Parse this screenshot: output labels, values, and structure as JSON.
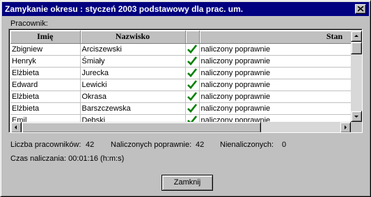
{
  "window": {
    "title": "Zamykanie okresu : styczeń 2003 podstawowy dla prac. um."
  },
  "group_label": "Pracownik:",
  "grid": {
    "columns": [
      "Imię",
      "Nazwisko",
      "",
      "Stan"
    ],
    "rows": [
      {
        "first": "Zbigniew",
        "last": "Arciszewski",
        "ok": true,
        "status": "naliczony poprawnie"
      },
      {
        "first": "Henryk",
        "last": "Śmiały",
        "ok": true,
        "status": "naliczony poprawnie"
      },
      {
        "first": "Elżbieta",
        "last": "Jurecka",
        "ok": true,
        "status": "naliczony poprawnie"
      },
      {
        "first": "Edward",
        "last": "Lewicki",
        "ok": true,
        "status": "naliczony poprawnie"
      },
      {
        "first": "Elżbieta",
        "last": "Okrasa",
        "ok": true,
        "status": "naliczony poprawnie"
      },
      {
        "first": "Elżbieta",
        "last": "Barszczewska",
        "ok": true,
        "status": "naliczony poprawnie"
      },
      {
        "first": "Emil",
        "last": "Dębski",
        "ok": true,
        "status": "naliczony poprawnie"
      }
    ],
    "check_color": "#008000"
  },
  "stats": {
    "employees_label": "Liczba pracowników:",
    "employees_value": "42",
    "correct_label": "Naliczonych poprawnie:",
    "correct_value": "42",
    "failed_label": "Nienaliczonych:",
    "failed_value": "0"
  },
  "time": {
    "text": "Czas naliczania: 00:01:16 (h:m:s)"
  },
  "buttons": {
    "close_label": "Zamknij"
  },
  "icons": {
    "close": "close-icon",
    "check": "check-icon",
    "arrow_up": "arrow-up-icon",
    "arrow_down": "arrow-down-icon",
    "arrow_left": "arrow-left-icon",
    "arrow_right": "arrow-right-icon"
  }
}
